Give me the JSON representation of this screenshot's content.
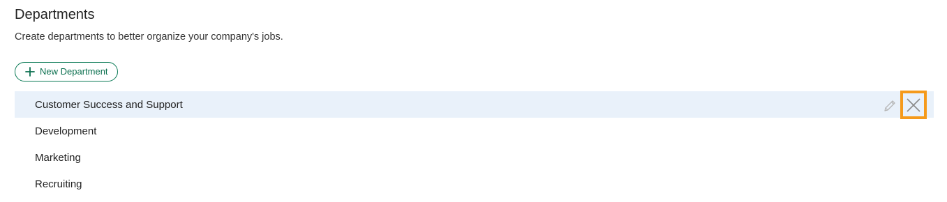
{
  "page": {
    "title": "Departments",
    "subtitle": "Create departments to better organize your company's jobs."
  },
  "toolbar": {
    "new_department_label": "New Department"
  },
  "departments": [
    {
      "name": "Customer Success and Support"
    },
    {
      "name": "Development"
    },
    {
      "name": "Marketing"
    },
    {
      "name": "Recruiting"
    }
  ],
  "colors": {
    "accent": "#0a7a55",
    "highlight_row": "#e9f1fa",
    "focus_outline": "#f59a1b"
  },
  "icons": {
    "add": "plus-icon",
    "edit": "pencil-icon",
    "delete": "close-icon"
  }
}
